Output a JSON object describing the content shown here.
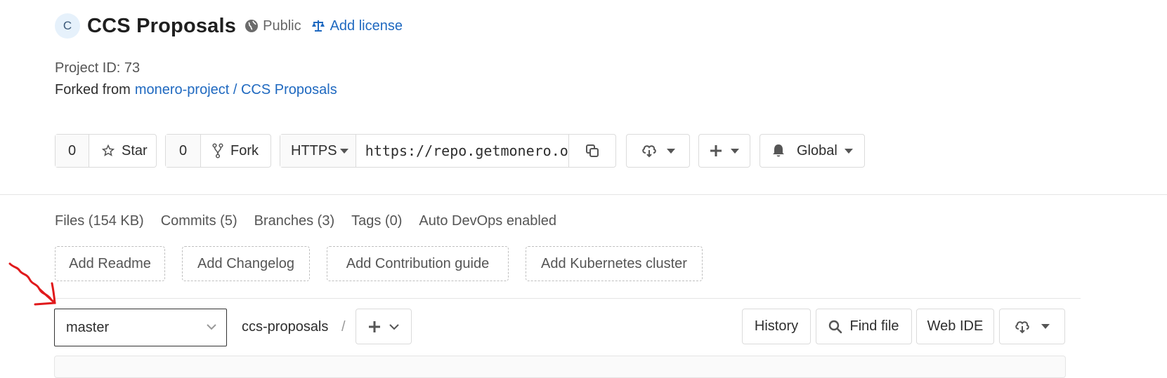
{
  "project": {
    "avatar_letter": "C",
    "title": "CCS Proposals",
    "visibility": "Public",
    "license_link": "Add license",
    "id_text": "Project ID: 73",
    "forked_prefix": "Forked from",
    "forked_link": "monero-project / CCS Proposals"
  },
  "actions": {
    "star_count": "0",
    "star_label": "Star",
    "fork_count": "0",
    "fork_label": "Fork",
    "protocol": "HTTPS",
    "clone_url": "https://repo.getmonero.org/xxxxx/ccs-proposals.git",
    "notification": "Global"
  },
  "stats": [
    "Files (154 KB)",
    "Commits (5)",
    "Branches (3)",
    "Tags (0)",
    "Auto DevOps enabled"
  ],
  "suggestions": [
    "Add Readme",
    "Add Changelog",
    "Add Contribution guide",
    "Add Kubernetes cluster"
  ],
  "repo": {
    "branch": "master",
    "path": "ccs-proposals",
    "separator": "/",
    "history": "History",
    "find_file": "Find file",
    "web_ide": "Web IDE"
  },
  "colors": {
    "link": "#1f69c0",
    "annotation": "#e0191b"
  },
  "icons": [
    "globe-icon",
    "scale-icon",
    "star-icon",
    "fork-icon",
    "copy-icon",
    "download-icon",
    "plus-icon",
    "bell-icon",
    "search-icon",
    "chevron-down-icon"
  ]
}
